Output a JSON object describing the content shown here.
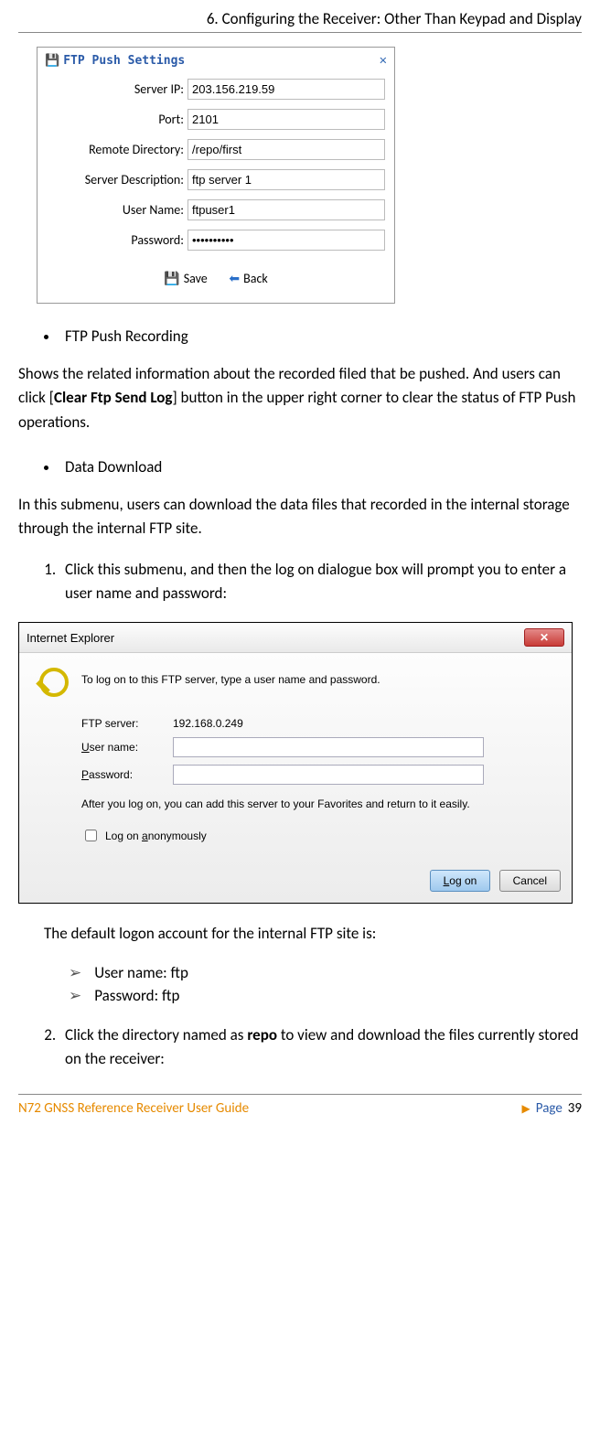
{
  "header": {
    "title": "6. Configuring the Receiver: Other Than Keypad and Display"
  },
  "ftp_dialog": {
    "title": "FTP Push Settings",
    "fields": {
      "server_ip": {
        "label": "Server IP:",
        "value": "203.156.219.59"
      },
      "port": {
        "label": "Port:",
        "value": "2101"
      },
      "remote_dir": {
        "label": "Remote Directory:",
        "value": "/repo/first"
      },
      "server_desc": {
        "label": "Server Description:",
        "value": "ftp server 1"
      },
      "user_name": {
        "label": "User Name:",
        "value": "ftpuser1"
      },
      "password": {
        "label": "Password:",
        "value": "••••••••••"
      }
    },
    "buttons": {
      "save": "Save",
      "back": "Back"
    }
  },
  "bullets": {
    "b1": "FTP Push Recording",
    "b2": "Data Download"
  },
  "paragraphs": {
    "p1a": "Shows the related information about the recorded filed that be pushed. And users can click [",
    "p1b": "Clear Ftp Send Log",
    "p1c": "] button in the upper right corner to clear the status of FTP Push operations.",
    "p2": "In this submenu, users can download the data files that recorded in the internal storage through the internal FTP site.",
    "step1": "Click this submenu, and then the log on dialogue box will prompt you to enter a user name and password:",
    "p3": "The default logon account for the internal FTP site is:",
    "cred1": "User name: ftp",
    "cred2": "Password: ftp",
    "step2a": "Click the directory named as ",
    "step2b": "repo",
    "step2c": " to view and download the files currently stored on the receiver:"
  },
  "ie_dialog": {
    "title": "Internet Explorer",
    "message": "To log on to this FTP server, type a user name and password.",
    "ftp_server_label": "FTP server:",
    "ftp_server_value": "192.168.0.249",
    "user_label_pre": "U",
    "user_label_post": "ser name:",
    "pass_label_pre": "P",
    "pass_label_post": "assword:",
    "note": "After you log on, you can add this server to your Favorites and return to it easily.",
    "anon_pre": "Log on ",
    "anon_u": "a",
    "anon_post": "nonymously",
    "logon_pre": "L",
    "logon_post": "og on",
    "cancel": "Cancel"
  },
  "footer": {
    "guide": "N72 GNSS Reference Receiver User Guide",
    "page_label": "Page",
    "page_num": "39"
  }
}
